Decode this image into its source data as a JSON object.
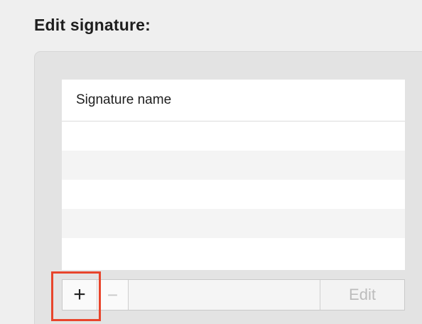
{
  "section": {
    "title": "Edit signature:"
  },
  "table": {
    "column_header": "Signature name",
    "rows": [
      "",
      "",
      "",
      "",
      ""
    ]
  },
  "toolbar": {
    "add_label": "+",
    "remove_label": "−",
    "edit_label": "Edit"
  },
  "colors": {
    "highlight": "#e8452c"
  }
}
